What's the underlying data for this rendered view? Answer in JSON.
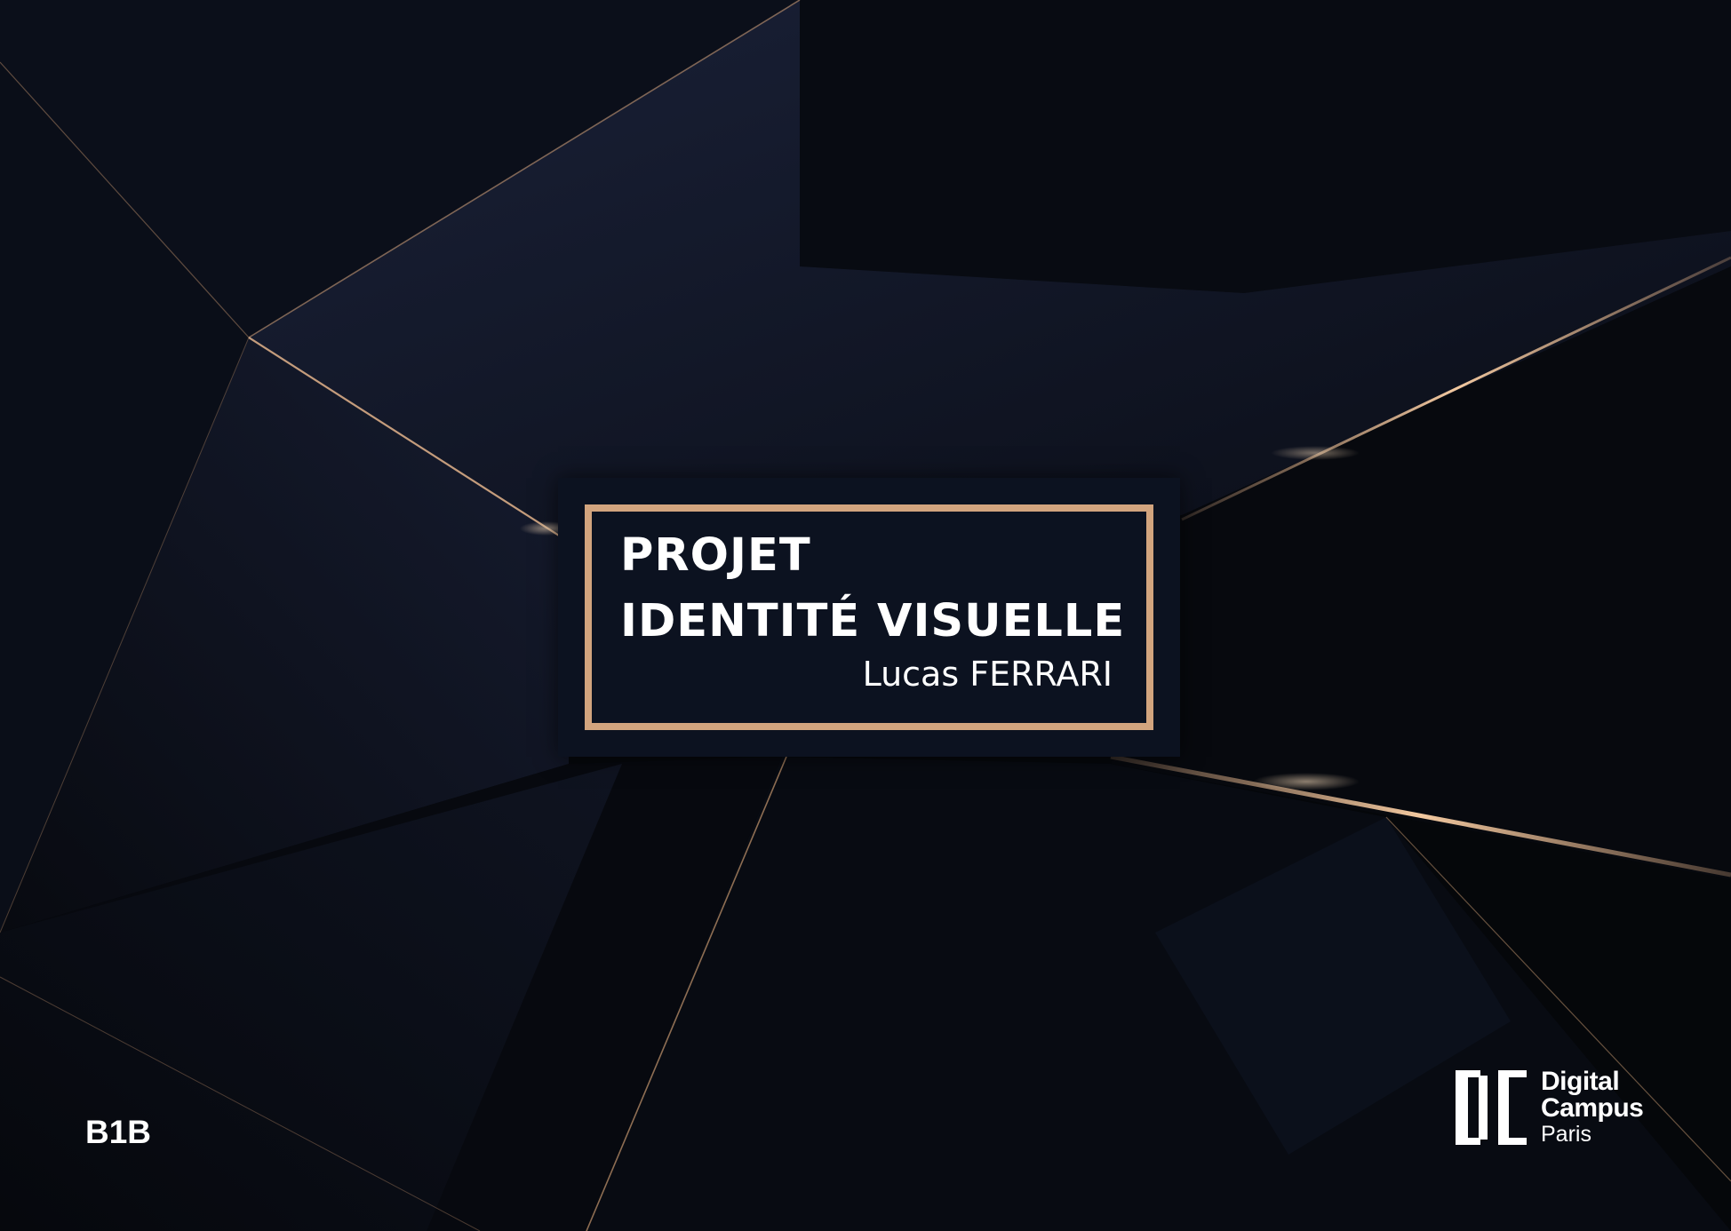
{
  "cover": {
    "title_line_1": "PROJET",
    "title_line_2": "IDENTITÉ VISUELLE",
    "author_first": "Lucas",
    "author_last": "FERRARI",
    "class_code": "B1B"
  },
  "logo": {
    "name_line_1": "Digital",
    "name_line_2": "Campus",
    "name_line_3": "Paris",
    "mark_icon": "dc-monogram-icon"
  },
  "colors": {
    "background": "#06080c",
    "panel_navy": "#0c1220",
    "gold_accent": "#d2a47e",
    "text": "#ffffff"
  }
}
